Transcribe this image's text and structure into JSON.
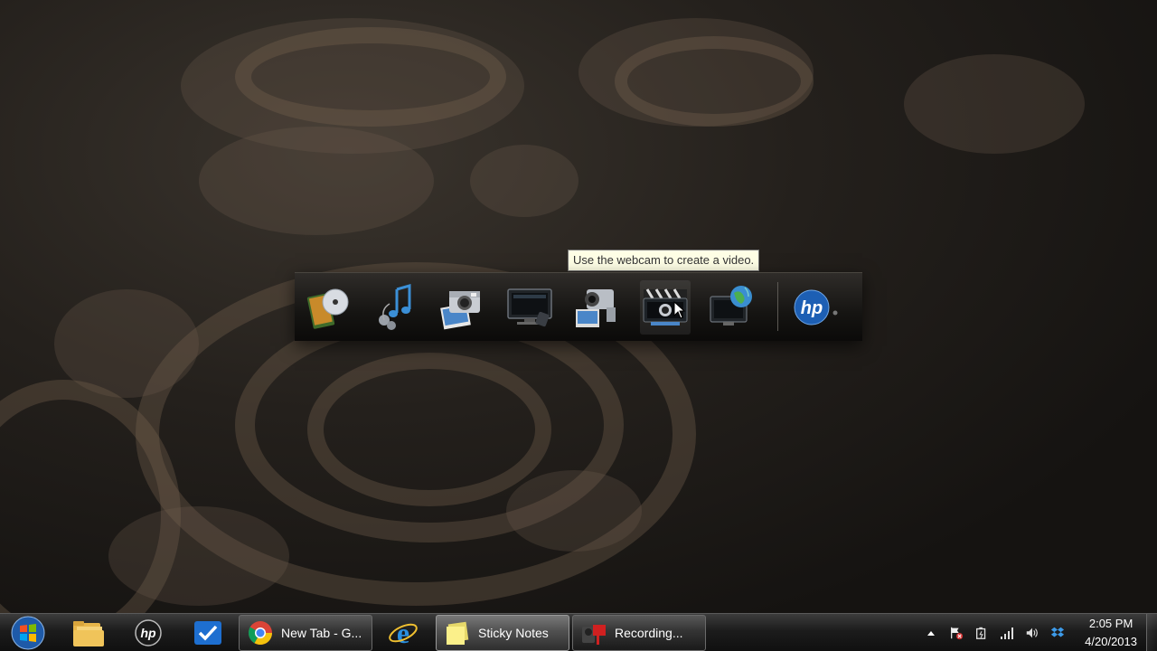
{
  "dock": {
    "tooltip": "Use the webcam to create a video.",
    "items": [
      {
        "icon": "media-dvd-icon"
      },
      {
        "icon": "music-icon"
      },
      {
        "icon": "photo-camera-icon"
      },
      {
        "icon": "tv-monitor-icon"
      },
      {
        "icon": "video-camera-icon"
      },
      {
        "icon": "webcam-video-icon",
        "active": true
      },
      {
        "icon": "web-globe-icon"
      },
      {
        "icon": "hp-logo-icon"
      }
    ]
  },
  "taskbar": {
    "pinned": [
      {
        "icon": "file-explorer-icon"
      },
      {
        "icon": "hp-icon"
      },
      {
        "icon": "checkmark-app-icon"
      },
      {
        "icon": "internet-explorer-icon"
      }
    ],
    "tasks": [
      {
        "label": "New Tab - G...",
        "icon": "chrome-icon"
      },
      {
        "label": "Sticky Notes",
        "icon": "sticky-notes-icon"
      },
      {
        "label": "Recording...",
        "icon": "recording-icon"
      }
    ],
    "clock": {
      "time": "2:05 PM",
      "date": "4/20/2013"
    },
    "tray_icons": [
      "show-hidden-icons-icon",
      "action-center-flag-icon",
      "power-icon",
      "network-signal-icon",
      "volume-icon",
      "dropbox-icon"
    ]
  },
  "colors": {
    "tooltip_bg": "#ffffe6",
    "taskbar": "#1c1c1c",
    "hp_blue": "#1d5fb4"
  }
}
